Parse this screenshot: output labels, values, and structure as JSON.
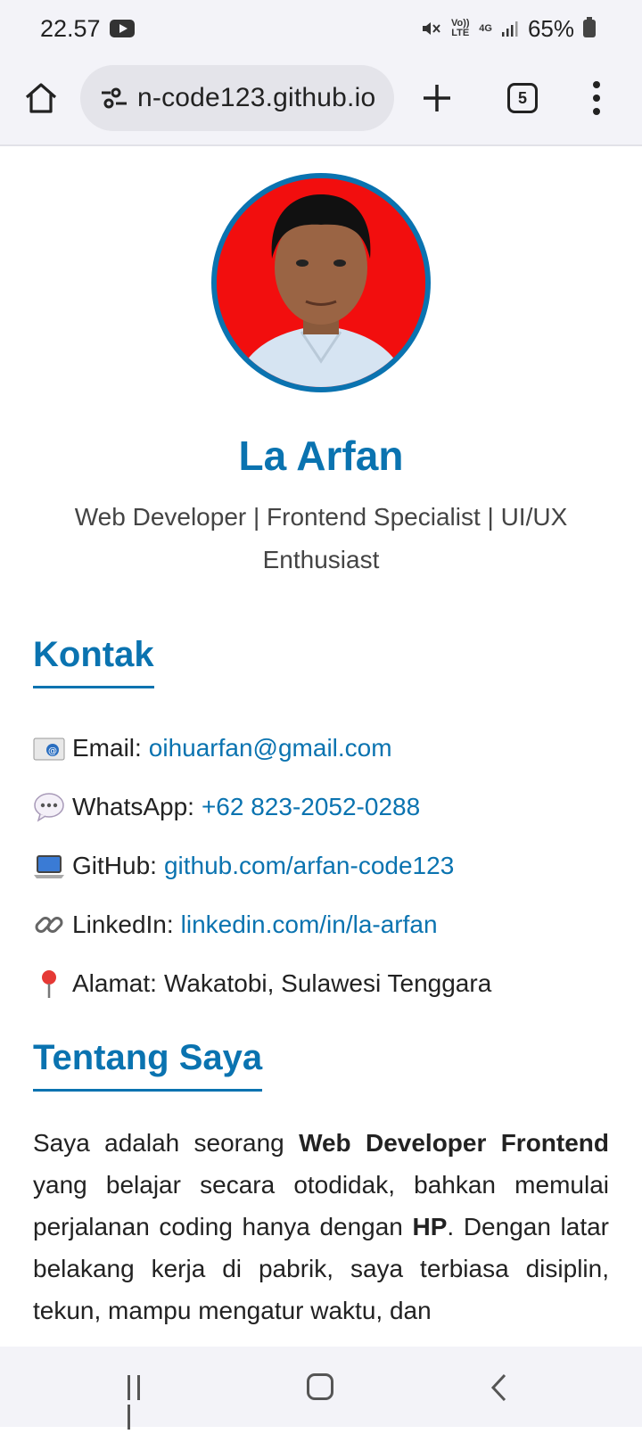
{
  "status_bar": {
    "time": "22.57",
    "volte_label": "Vo)) LTE",
    "network_label": "4G",
    "battery": "65%"
  },
  "browser": {
    "url": "n-code123.github.io",
    "tab_count": "5"
  },
  "profile": {
    "name": "La Arfan",
    "tagline": "Web Developer | Frontend Specialist | UI/UX Enthusiast"
  },
  "contact": {
    "title": "Kontak",
    "items": [
      {
        "icon": "email-icon",
        "label": "Email:",
        "value": "oihuarfan@gmail.com"
      },
      {
        "icon": "speech-bubble-icon",
        "label": "WhatsApp:",
        "value": "+62 823-2052-0288"
      },
      {
        "icon": "laptop-icon",
        "label": "GitHub:",
        "value": "github.com/arfan-code123"
      },
      {
        "icon": "link-icon",
        "label": "LinkedIn:",
        "value": "linkedin.com/in/la-arfan"
      },
      {
        "icon": "pin-icon",
        "label": "Alamat:",
        "value": "Wakatobi, Sulawesi Tenggara"
      }
    ]
  },
  "about": {
    "title": "Tentang Saya",
    "p1": "Saya adalah seorang ",
    "b1": "Web Developer Frontend",
    "p2": " yang belajar secara otodidak, bahkan memulai perjalanan coding hanya dengan ",
    "b2": "HP",
    "p3": ". Dengan latar belakang kerja di pabrik, saya terbiasa disiplin, tekun, mampu mengatur waktu, dan"
  },
  "colors": {
    "accent": "#0a73b0",
    "avatar_background": "#f20e0e"
  }
}
